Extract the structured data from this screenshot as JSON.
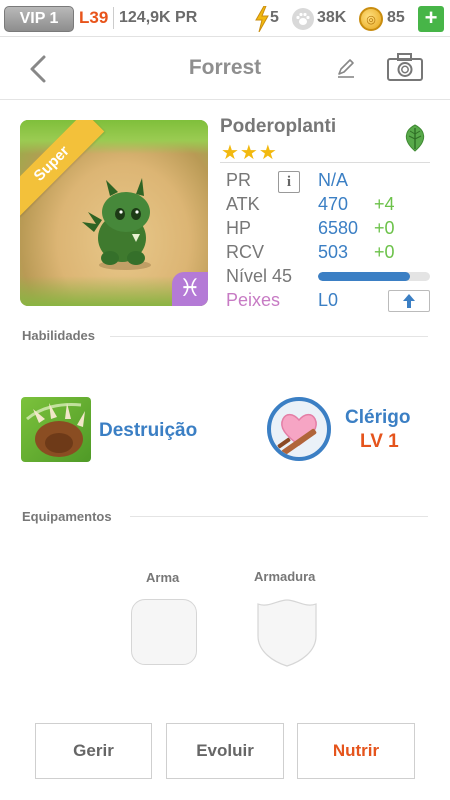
{
  "status_bar": {
    "vip": "VIP 1",
    "level": "L39",
    "pr": "124,9K PR",
    "energy": "5",
    "paws": "38K",
    "coins": "85",
    "plus": "+"
  },
  "header": {
    "title": "Forrest"
  },
  "pet": {
    "rarity_ribbon": "Super",
    "zodiac_symbol": "♓",
    "name": "Poderoplanti",
    "stars": "★★★",
    "element_icon": "leaf-icon",
    "stats": {
      "pr": {
        "label": "PR",
        "info": "i",
        "value": "N/A"
      },
      "atk": {
        "label": "ATK",
        "value": "470",
        "delta": "+4"
      },
      "hp": {
        "label": "HP",
        "value": "6580",
        "delta": "+0"
      },
      "rcv": {
        "label": "RCV",
        "value": "503",
        "delta": "+0"
      },
      "level": {
        "label": "Nível 45",
        "progress": 0.82
      },
      "fish": {
        "label": "Peixes",
        "value": "L0"
      }
    }
  },
  "skills": {
    "heading": "Habilidades",
    "active": {
      "name": "Destruição"
    },
    "leader": {
      "name": "Clérigo",
      "level": "LV 1"
    }
  },
  "equipment": {
    "heading": "Equipamentos",
    "weapon_label": "Arma",
    "armor_label": "Armadura"
  },
  "actions": {
    "manage": "Gerir",
    "evolve": "Evoluir",
    "feed": "Nutrir"
  },
  "colors": {
    "accent_blue": "#3b7fc4",
    "accent_orange": "#e5541c",
    "delta_green": "#6cc24a",
    "star_gold": "#f2b90f",
    "fish_pink": "#c77bc4"
  }
}
